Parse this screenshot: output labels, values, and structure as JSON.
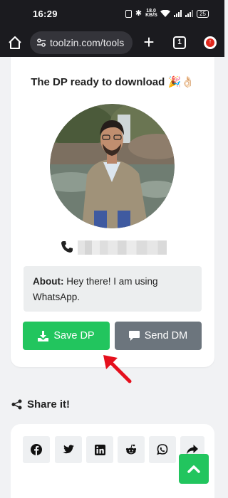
{
  "status_bar": {
    "time": "16:29",
    "net_speed": "18.0 KB/S",
    "battery": "25"
  },
  "browser": {
    "url": "toolzin.com/tools",
    "tab_count": "1"
  },
  "card": {
    "title": "The DP ready to download",
    "title_emoji": "🎉👌🏻",
    "about_label": "About:",
    "about_text": " Hey there! I am using WhatsApp.",
    "save_label": "Save DP",
    "dm_label": "Send DM"
  },
  "share": {
    "heading": "Share it!",
    "buttons": [
      "facebook-icon",
      "twitter-icon",
      "linkedin-icon",
      "reddit-icon",
      "whatsapp-icon",
      "share-arrow-icon"
    ]
  },
  "colors": {
    "accent_green": "#22c55e",
    "gray_button": "#6c757d",
    "annotation_red": "#e5101d"
  }
}
